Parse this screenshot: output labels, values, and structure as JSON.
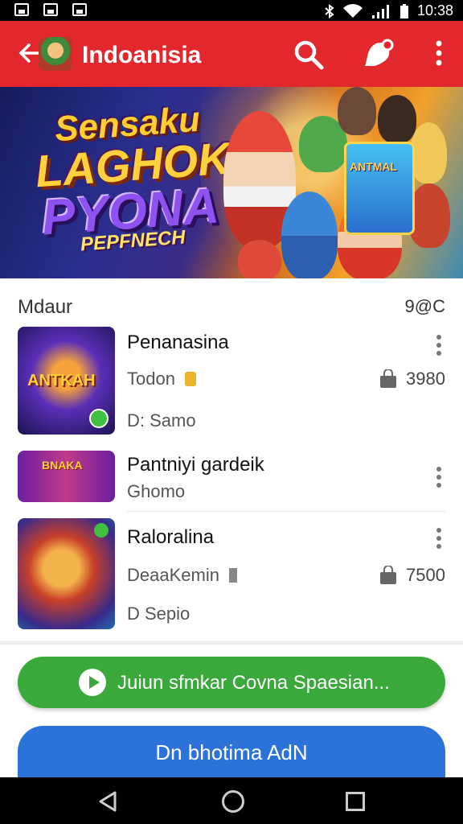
{
  "status_bar": {
    "time": "10:38"
  },
  "app_bar": {
    "title": "Indoanisia"
  },
  "banner": {
    "line1": "Sensaku",
    "line2": "LAGHOK",
    "line3": "PYONA",
    "line4": "PEPFNECH",
    "card_text": "ANTMAL"
  },
  "section": {
    "title": "Mdaur",
    "count": "9@C"
  },
  "rows": [
    {
      "title": "Penanasina",
      "subtitle": "Todon",
      "extra": "D: Samo",
      "price": "3980",
      "thumb_text": "ANTKAH"
    },
    {
      "title": "Pantniyi gardeik",
      "subtitle": "Ghomo",
      "extra": "",
      "price": "",
      "thumb_text": "BNAKA"
    },
    {
      "title": "Raloralina",
      "subtitle": "DeaaKemin",
      "extra": "D Sepio",
      "price": "7500",
      "thumb_text": ""
    }
  ],
  "buttons": {
    "primary": "Juiun sfmkar Covna Spaesian...",
    "secondary": "Dn bhotima AdN"
  },
  "colors": {
    "app_bar": "#e2282d",
    "primary_button": "#3aa83a",
    "secondary_button": "#2c73d9"
  }
}
